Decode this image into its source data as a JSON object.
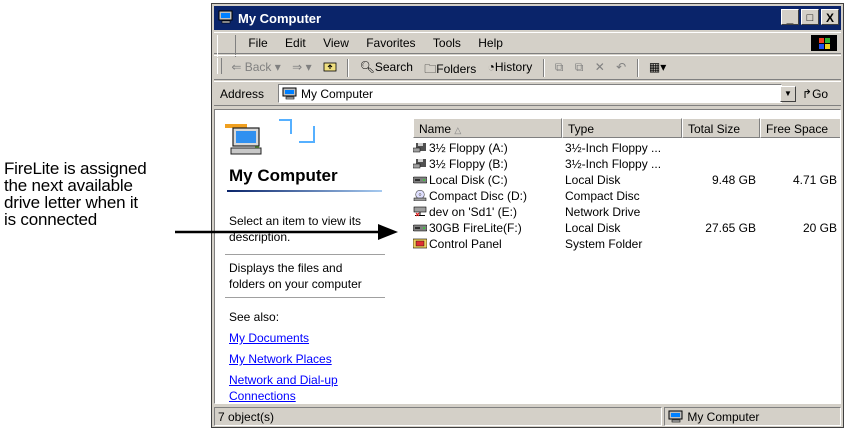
{
  "callout": {
    "lines": [
      "FireLite is assigned",
      "the next available",
      "drive letter when it",
      "is connected"
    ]
  },
  "window": {
    "title": "My Computer",
    "controls": {
      "minimize": "_",
      "maximize": "□",
      "close": "X"
    }
  },
  "menu": [
    "File",
    "Edit",
    "View",
    "Favorites",
    "Tools",
    "Help"
  ],
  "toolbar": {
    "back": "Back",
    "forward_icon": "arrow-right-icon",
    "up_icon": "up-folder-icon",
    "search": "Search",
    "folders": "Folders",
    "history": "History",
    "move_to_icon": "move-to-icon",
    "copy_to_icon": "copy-to-icon",
    "delete_icon": "delete-icon",
    "undo_icon": "undo-icon",
    "views_icon": "views-icon"
  },
  "address": {
    "label": "Address",
    "value": "My Computer",
    "go": "Go"
  },
  "pane": {
    "heading": "My Computer",
    "description": "Select an item to view its description.",
    "info": "Displays the files and folders on your computer",
    "see_also": "See also:",
    "links": [
      "My Documents",
      "My Network Places",
      "Network and Dial-up",
      "Connections"
    ]
  },
  "columns": {
    "name": "Name",
    "type": "Type",
    "total_size": "Total Size",
    "free_space": "Free Space"
  },
  "items": [
    {
      "name": "3½ Floppy (A:)",
      "type": "3½-Inch Floppy ...",
      "total": "",
      "free": "",
      "icon": "floppy-icon"
    },
    {
      "name": "3½ Floppy (B:)",
      "type": "3½-Inch Floppy ...",
      "total": "",
      "free": "",
      "icon": "floppy-icon"
    },
    {
      "name": "Local Disk (C:)",
      "type": "Local Disk",
      "total": "9.48 GB",
      "free": "4.71 GB",
      "icon": "hard-disk-icon"
    },
    {
      "name": "Compact Disc (D:)",
      "type": "Compact Disc",
      "total": "",
      "free": "",
      "icon": "cd-drive-icon"
    },
    {
      "name": "dev on 'Sd1' (E:)",
      "type": "Network Drive",
      "total": "",
      "free": "",
      "icon": "network-drive-icon"
    },
    {
      "name": "30GB FireLite(F:)",
      "type": "Local Disk",
      "total": "27.65 GB",
      "free": "20 GB",
      "icon": "hard-disk-icon"
    },
    {
      "name": "Control Panel",
      "type": "System Folder",
      "total": "",
      "free": "",
      "icon": "control-panel-icon"
    }
  ],
  "status": {
    "count": "7 object(s)",
    "zone": "My Computer"
  },
  "colors": {
    "titlebar": "#0a246a",
    "chrome": "#d4d0c8",
    "link": "#0000ff"
  }
}
